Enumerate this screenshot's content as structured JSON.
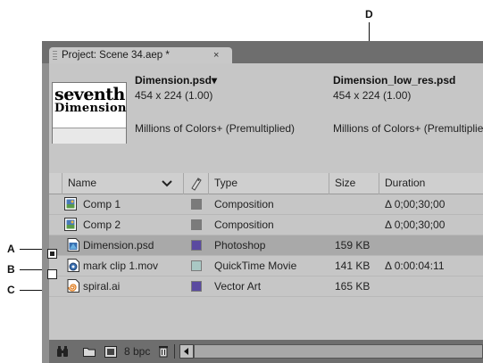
{
  "callouts": {
    "a": "A",
    "b": "B",
    "c": "C",
    "d": "D"
  },
  "tab": {
    "title": "Project: Scene 34.aep *",
    "close": "×"
  },
  "thumbnail": {
    "line1": "seventh",
    "line2": "Dimension"
  },
  "footage_left": {
    "name": "Dimension.psd",
    "arrow": "▾",
    "dims": "454 x 224 (1.00)",
    "colors": "Millions of Colors+ (Premultiplied)"
  },
  "footage_right": {
    "name": "Dimension_low_res.psd",
    "dims": "454 x 224 (1.00)",
    "colors": "Millions of Colors+ (Premultiplied)"
  },
  "columns": {
    "name": "Name",
    "type": "Type",
    "size": "Size",
    "duration": "Duration"
  },
  "rows": [
    {
      "name": "Comp 1",
      "type": "Composition",
      "size": "",
      "duration": "Δ 0;00;30;00",
      "label_color": "#7b7b7b",
      "icon": "composition-icon"
    },
    {
      "name": "Comp 2",
      "type": "Composition",
      "size": "",
      "duration": "Δ 0;00;30;00",
      "label_color": "#7b7b7b",
      "icon": "composition-icon"
    },
    {
      "name": "Dimension.psd",
      "type": "Photoshop",
      "size": "159 KB",
      "duration": "",
      "label_color": "#5a4aa0",
      "icon": "photoshop-file-icon"
    },
    {
      "name": "mark clip 1.mov",
      "type": "QuickTime Movie",
      "size": "141 KB",
      "duration": "Δ 0:00:04:11",
      "label_color": "#a9c8c4",
      "icon": "quicktime-file-icon"
    },
    {
      "name": "spiral.ai",
      "type": "Vector Art",
      "size": "165 KB",
      "duration": "",
      "label_color": "#5a4aa0",
      "icon": "illustrator-file-icon"
    }
  ],
  "status": {
    "bpc": "8 bpc"
  },
  "icons": [
    "find-icon",
    "new-folder-icon",
    "new-composition-icon",
    "trash-icon",
    "scroll-left-icon",
    "name-sort-chevron-icon",
    "label-column-icon"
  ]
}
